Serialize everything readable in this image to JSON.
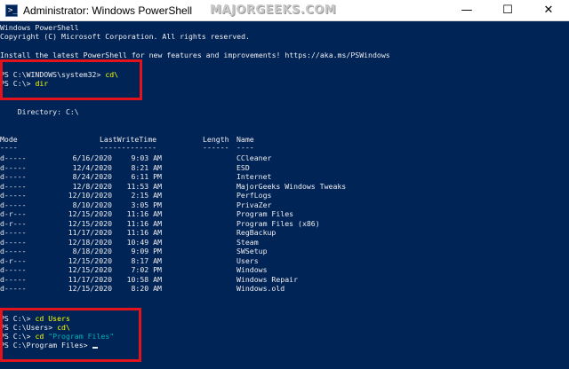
{
  "window": {
    "title": "Administrator: Windows PowerShell",
    "watermark": "MAJORGEEKS.COM",
    "minimize_glyph": "—",
    "maximize_glyph": "☐",
    "close_glyph": "✕",
    "app_icon_glyph": ">_",
    "app_icon_name": "powershell-icon"
  },
  "header_lines": [
    "Windows PowerShell",
    "Copyright (C) Microsoft Corporation. All rights reserved.",
    "",
    "Install the latest PowerShell for new features and improvements! https://aka.ms/PSWindows"
  ],
  "session1": [
    {
      "prompt": "PS C:\\WINDOWS\\system32> ",
      "command": "cd\\"
    },
    {
      "prompt": "PS C:\\> ",
      "command": "dir"
    }
  ],
  "directory_label": "    Directory: C:\\",
  "table": {
    "headers": [
      "Mode",
      "LastWriteTime",
      "Length",
      "Name"
    ],
    "underline": [
      "----",
      "-------------",
      "------",
      "----"
    ],
    "rows": [
      {
        "mode": "d-----",
        "date": "6/16/2020",
        "time": "9:03 AM",
        "name": "CCleaner"
      },
      {
        "mode": "d-----",
        "date": "12/4/2020",
        "time": "8:21 AM",
        "name": "ESD"
      },
      {
        "mode": "d-----",
        "date": "8/24/2020",
        "time": "6:11 PM",
        "name": "Internet"
      },
      {
        "mode": "d-----",
        "date": "12/8/2020",
        "time": "11:53 AM",
        "name": "MajorGeeks Windows Tweaks"
      },
      {
        "mode": "d-----",
        "date": "12/10/2020",
        "time": "2:15 AM",
        "name": "PerfLogs"
      },
      {
        "mode": "d-----",
        "date": "8/10/2020",
        "time": "3:05 PM",
        "name": "PrivaZer"
      },
      {
        "mode": "d-r---",
        "date": "12/15/2020",
        "time": "11:16 AM",
        "name": "Program Files"
      },
      {
        "mode": "d-r---",
        "date": "12/15/2020",
        "time": "11:16 AM",
        "name": "Program Files (x86)"
      },
      {
        "mode": "d-----",
        "date": "11/17/2020",
        "time": "11:16 AM",
        "name": "RegBackup"
      },
      {
        "mode": "d-----",
        "date": "12/18/2020",
        "time": "10:49 AM",
        "name": "Steam"
      },
      {
        "mode": "d-----",
        "date": "8/18/2020",
        "time": "9:09 PM",
        "name": "SWSetup"
      },
      {
        "mode": "d-r---",
        "date": "12/15/2020",
        "time": "8:17 AM",
        "name": "Users"
      },
      {
        "mode": "d-----",
        "date": "12/15/2020",
        "time": "7:02 PM",
        "name": "Windows"
      },
      {
        "mode": "d-----",
        "date": "11/17/2020",
        "time": "10:58 AM",
        "name": "Windows Repair"
      },
      {
        "mode": "d-----",
        "date": "12/15/2020",
        "time": "8:20 AM",
        "name": "Windows.old"
      }
    ]
  },
  "session2": [
    {
      "prompt": "PS C:\\> ",
      "command": "cd Users",
      "arg": ""
    },
    {
      "prompt": "PS C:\\Users> ",
      "command": "cd\\",
      "arg": ""
    },
    {
      "prompt": "PS C:\\> ",
      "command": "cd ",
      "arg": "\"Program Files\""
    },
    {
      "prompt": "PS C:\\Program Files> ",
      "command": "",
      "arg": ""
    }
  ],
  "colors": {
    "background": "#012456",
    "text": "#eeedf0",
    "command": "#ffff00",
    "string": "#00b3b3",
    "highlight": "#e3131b"
  }
}
